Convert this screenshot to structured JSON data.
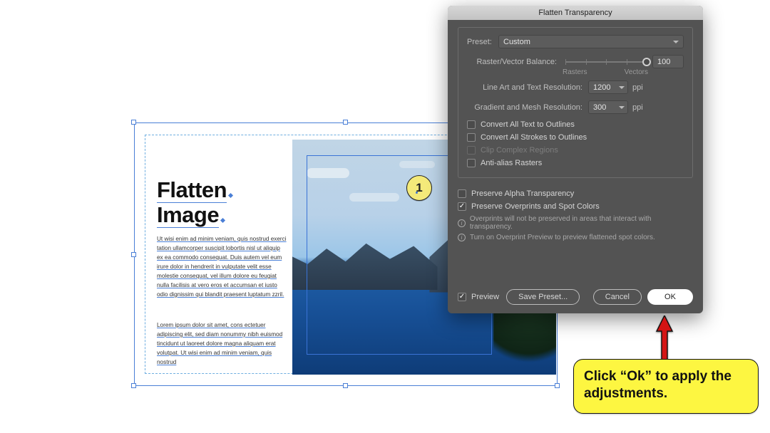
{
  "document": {
    "title_line1": "Flatten",
    "title_line2": "Image",
    "para1": "Ut wisi enim ad minim veniam, quis nostrud exerci tation ullamcorper suscipit lobortis nisl ut aliquip ex ea commodo consequat. Duis autem vel eum irure dolor in hendrerit in vulputate velit esse molestie consequat, vel illum dolore eu feugiat nulla facilisis at vero eros et accumsan et iusto odio dignissim qui blandit praesent luptatum zzril.",
    "para2": "Lorem ipsum dolor sit amet, cons ectetuer adipiscing elit, sed diam nonummy nibh euismod tincidunt ut laoreet dolore magna aliquam erat volutpat. Ut wisi enim ad minim veniam, quis nostrud",
    "step_badge": "1"
  },
  "dialog": {
    "title": "Flatten Transparency",
    "preset_label": "Preset:",
    "preset_value": "Custom",
    "balance_label": "Raster/Vector Balance:",
    "balance_value": "100",
    "balance_min_label": "Rasters",
    "balance_max_label": "Vectors",
    "lineart_label": "Line Art and Text Resolution:",
    "lineart_value": "1200",
    "lineart_unit": "ppi",
    "gradient_label": "Gradient and Mesh Resolution:",
    "gradient_value": "300",
    "gradient_unit": "ppi",
    "cb_text_outlines": "Convert All Text to Outlines",
    "cb_stroke_outlines": "Convert All Strokes to Outlines",
    "cb_clip_regions": "Clip Complex Regions",
    "cb_antialias": "Anti-alias Rasters",
    "cb_alpha": "Preserve Alpha Transparency",
    "cb_overprint": "Preserve Overprints and Spot Colors",
    "info1": "Overprints will not be preserved in areas that interact with transparency.",
    "info2": "Turn on Overprint Preview to preview flattened spot colors.",
    "preview_label": "Preview",
    "save_preset": "Save Preset...",
    "cancel": "Cancel",
    "ok": "OK"
  },
  "callout": {
    "text": "Click “Ok” to apply the adjustments."
  }
}
